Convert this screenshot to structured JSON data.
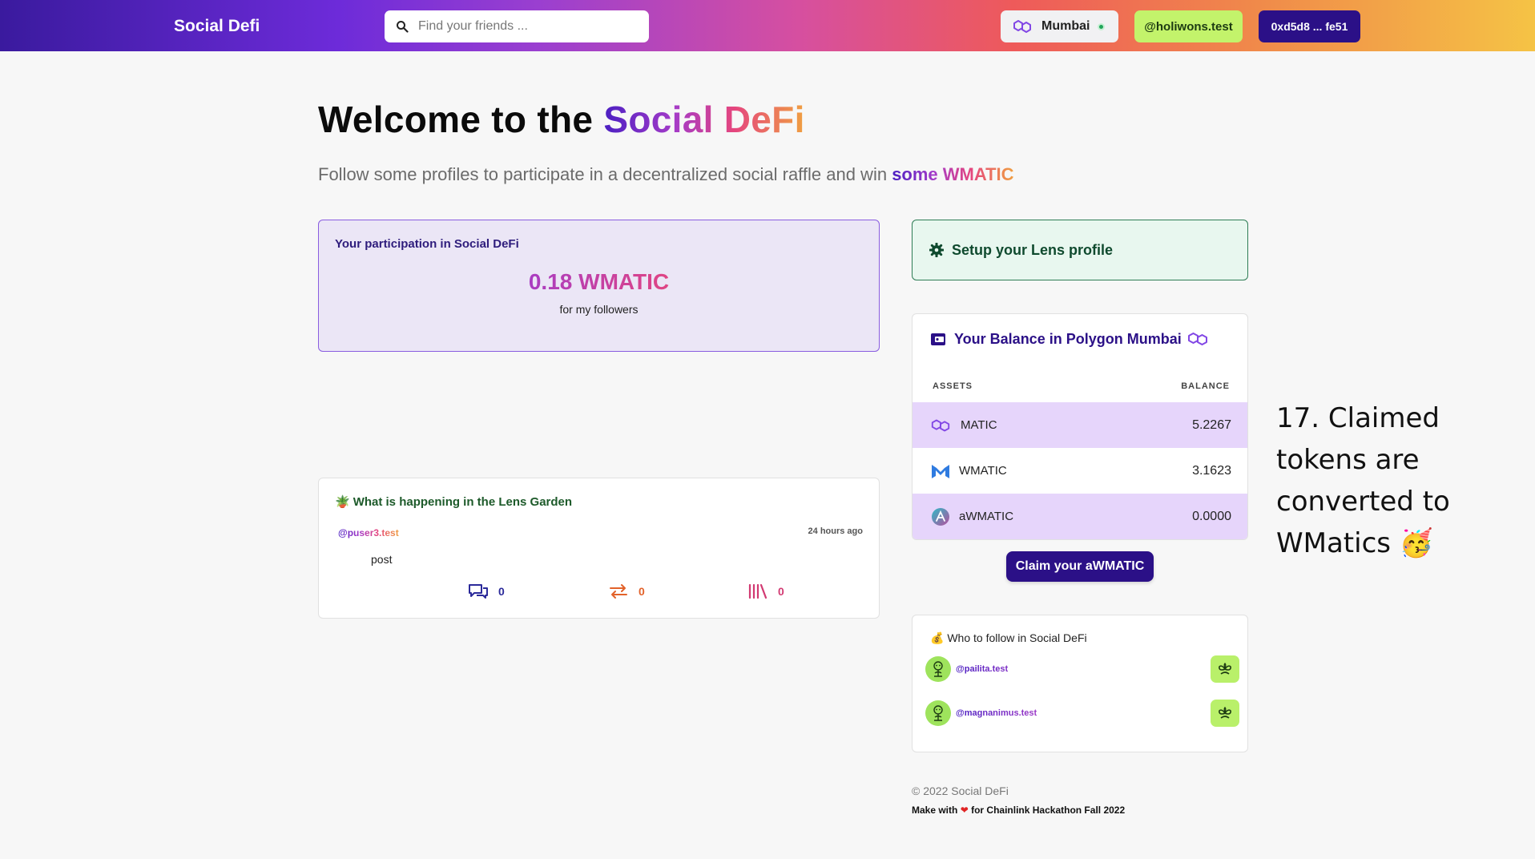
{
  "header": {
    "brand": "Social Defi",
    "search_placeholder": "Find your friends ...",
    "network_label": "Mumbai",
    "handle": "@holiwons.test",
    "address": "0xd5d8 ... fe51",
    "colors": {
      "gradient_start": "#3a1a9e",
      "gradient_end": "#f5c345",
      "address_bg": "#2b1087",
      "handle_bg": "#c3f36b"
    }
  },
  "hero": {
    "title_prefix": "Welcome to the ",
    "title_highlight": "Social DeFi",
    "subtitle_prefix": "Follow some profiles to participate in a decentralized social raffle and win ",
    "subtitle_highlight": "some WMATIC"
  },
  "participation": {
    "label": "Your participation in Social DeFi",
    "amount": "0.18",
    "unit": "WMATIC",
    "sub": "for my followers"
  },
  "feed": {
    "title": "What is happening in the Lens Garden",
    "title_icon": "plant-icon",
    "post": {
      "author": "@puser3.test",
      "time": "24 hours ago",
      "content": "post",
      "comments": "0",
      "mirrors": "0",
      "collects": "0"
    }
  },
  "lens_setup": {
    "label": "Setup your Lens profile",
    "icon": "gear-icon"
  },
  "balance": {
    "title": "Your Balance in Polygon Mumbai",
    "col_assets": "ASSETS",
    "col_balance": "BALANCE",
    "rows": [
      {
        "name": "MATIC",
        "value": "5.2267",
        "icon": "polygon-icon"
      },
      {
        "name": "WMATIC",
        "value": "3.1623",
        "icon": "wmatic-icon"
      },
      {
        "name": "aWMATIC",
        "value": "0.0000",
        "icon": "aave-icon"
      }
    ],
    "claim_label": "Claim your aWMATIC"
  },
  "who_to_follow": {
    "title": "Who to follow in Social DeFi",
    "title_icon": "money-bag-icon",
    "profiles": [
      {
        "handle": "@pailita.test"
      },
      {
        "handle": "@magnanimus.test"
      }
    ]
  },
  "footer": {
    "copyright": "© 2022 Social DeFi",
    "make_prefix": "Make with ",
    "make_suffix": " for Chainlink Hackathon Fall 2022"
  },
  "caption": {
    "text": "17. Claimed tokens are converted to WMatics",
    "emoji": "🥳"
  }
}
